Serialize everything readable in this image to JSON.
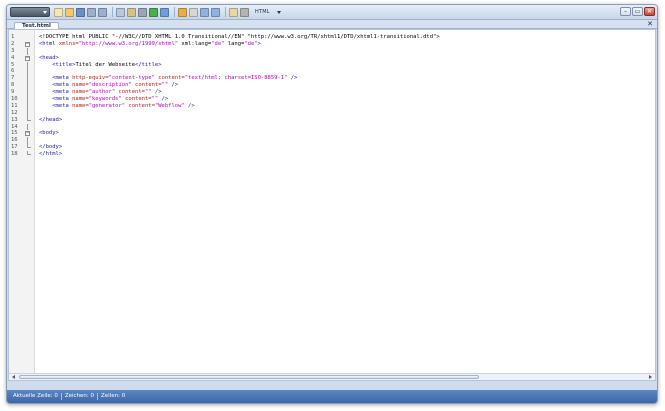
{
  "toolbar": {
    "app_menu_label": "",
    "icons": [
      "new-file-icon",
      "open-folder-icon",
      "save-icon",
      "undo-icon",
      "redo-icon",
      "copy-icon",
      "paste-icon",
      "print-icon",
      "browser-preview-icon",
      "link-icon",
      "image-icon",
      "settings-icon",
      "zoom-in-icon",
      "zoom-out-icon",
      "document-icon",
      "printer-icon"
    ],
    "icon_colors": [
      "#f5e7b0",
      "#f1c96a",
      "#6b8fc7",
      "#9ab0cc",
      "#9ab0cc",
      "#b7c7de",
      "#d9c08a",
      "#9aa5b5",
      "#4cae4c",
      "#6a9fd8",
      "#e3b04b",
      "#d6d6d6",
      "#8fb3de",
      "#8fb3de",
      "#e6d7a5",
      "#b3b3b3"
    ],
    "language": "HTML"
  },
  "window_controls": {
    "minimize": "–",
    "restore": "▭",
    "close": "✕"
  },
  "tab": {
    "label": "Test.html",
    "close": "✕"
  },
  "editor": {
    "lines": [
      {
        "n": "1",
        "fold": "",
        "segs": [
          {
            "c": "t-txt",
            "t": "<!DOCTYPE html PUBLIC \"-//W3C//DTD XHTML 1.0 Transitional//EN\" \"http://www.w3.org/TR/xhtml1/DTD/xhtml1-transitional.dtd\">"
          }
        ]
      },
      {
        "n": "2",
        "fold": "−",
        "segs": [
          {
            "c": "t-tag",
            "t": "<html "
          },
          {
            "c": "t-attr",
            "t": "xmlns="
          },
          {
            "c": "t-str",
            "t": "\"http://www.w3.org/1999/xhtml\""
          },
          {
            "c": "t-txt",
            "t": " xml:lang="
          },
          {
            "c": "t-str",
            "t": "\"de\""
          },
          {
            "c": "t-txt",
            "t": " lang="
          },
          {
            "c": "t-str",
            "t": "\"de\""
          },
          {
            "c": "t-tag",
            "t": ">"
          }
        ]
      },
      {
        "n": "3",
        "fold": "|",
        "segs": []
      },
      {
        "n": "4",
        "fold": "−",
        "segs": [
          {
            "c": "t-tag",
            "t": "<head>"
          }
        ]
      },
      {
        "n": "5",
        "fold": "|",
        "segs": [
          {
            "c": "t-tag",
            "t": "    <title>"
          },
          {
            "c": "t-txt",
            "t": "Titel der Webseite"
          },
          {
            "c": "t-tag",
            "t": "</title>"
          }
        ]
      },
      {
        "n": "6",
        "fold": "|",
        "segs": []
      },
      {
        "n": "7",
        "fold": "|",
        "segs": [
          {
            "c": "t-tag",
            "t": "    <meta "
          },
          {
            "c": "t-attr",
            "t": "http-equiv="
          },
          {
            "c": "t-str",
            "t": "\"content-type\""
          },
          {
            "c": "t-attr",
            "t": " content="
          },
          {
            "c": "t-str",
            "t": "\"text/html; charset=ISO-8859-1\""
          },
          {
            "c": "t-tag",
            "t": " />"
          }
        ]
      },
      {
        "n": "8",
        "fold": "|",
        "segs": [
          {
            "c": "t-tag",
            "t": "    <meta "
          },
          {
            "c": "t-attr",
            "t": "name="
          },
          {
            "c": "t-str",
            "t": "\"description\""
          },
          {
            "c": "t-attr",
            "t": " content="
          },
          {
            "c": "t-str",
            "t": "\"\""
          },
          {
            "c": "t-tag",
            "t": " />"
          }
        ]
      },
      {
        "n": "9",
        "fold": "|",
        "segs": [
          {
            "c": "t-tag",
            "t": "    <meta "
          },
          {
            "c": "t-attr",
            "t": "name="
          },
          {
            "c": "t-str",
            "t": "\"author\""
          },
          {
            "c": "t-attr",
            "t": " content="
          },
          {
            "c": "t-str",
            "t": "\"\""
          },
          {
            "c": "t-tag",
            "t": " />"
          }
        ]
      },
      {
        "n": "10",
        "fold": "|",
        "segs": [
          {
            "c": "t-tag",
            "t": "    <meta "
          },
          {
            "c": "t-attr",
            "t": "name="
          },
          {
            "c": "t-str",
            "t": "\"keywords\""
          },
          {
            "c": "t-attr",
            "t": " content="
          },
          {
            "c": "t-str",
            "t": "\"\""
          },
          {
            "c": "t-tag",
            "t": " />"
          }
        ]
      },
      {
        "n": "11",
        "fold": "|",
        "segs": [
          {
            "c": "t-tag",
            "t": "    <meta "
          },
          {
            "c": "t-attr",
            "t": "name="
          },
          {
            "c": "t-str",
            "t": "\"generator\""
          },
          {
            "c": "t-attr",
            "t": " content="
          },
          {
            "c": "t-str",
            "t": "\"Webflow\""
          },
          {
            "c": "t-tag",
            "t": " />"
          }
        ]
      },
      {
        "n": "12",
        "fold": "|",
        "segs": []
      },
      {
        "n": "13",
        "fold": "end",
        "segs": [
          {
            "c": "t-tag",
            "t": "</head>"
          }
        ]
      },
      {
        "n": "14",
        "fold": "|",
        "segs": []
      },
      {
        "n": "15",
        "fold": "−",
        "segs": [
          {
            "c": "t-tag",
            "t": "<body>"
          }
        ]
      },
      {
        "n": "16",
        "fold": "|",
        "segs": []
      },
      {
        "n": "17",
        "fold": "end",
        "segs": [
          {
            "c": "t-tag",
            "t": "</body>"
          }
        ]
      },
      {
        "n": "18",
        "fold": "end",
        "segs": [
          {
            "c": "t-tag",
            "t": "</html>"
          }
        ]
      }
    ]
  },
  "statusbar": {
    "line": "Aktuelle Zeile: 0",
    "chars": "Zeichen: 0",
    "rows": "Zeilen: 0"
  }
}
